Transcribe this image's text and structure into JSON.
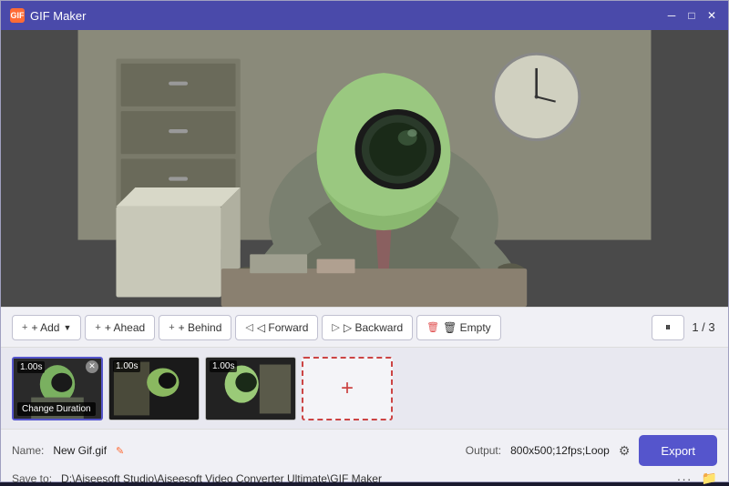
{
  "titlebar": {
    "title": "GIF Maker",
    "icon_label": "GIF",
    "minimize_label": "─",
    "maximize_label": "□",
    "close_label": "✕"
  },
  "toolbar": {
    "add_label": "+ Add",
    "ahead_label": "+ Ahead",
    "behind_label": "+ Behind",
    "forward_label": "◁ Forward",
    "backward_label": "▷ Backward",
    "empty_label": "🗑 Empty",
    "pause_label": "⏸",
    "page_indicator": "1 / 3"
  },
  "frames": [
    {
      "id": 1,
      "duration": "1.00s",
      "active": true,
      "has_close": true,
      "label": "Change Duration"
    },
    {
      "id": 2,
      "duration": "1.00s",
      "active": false,
      "has_close": false,
      "label": ""
    },
    {
      "id": 3,
      "duration": "1.00s",
      "active": false,
      "has_close": false,
      "label": ""
    }
  ],
  "bottom": {
    "name_label": "Name:",
    "name_value": "New Gif.gif",
    "output_label": "Output:",
    "output_value": "800x500;12fps;Loop",
    "save_label": "Save to:",
    "save_path": "D:\\Aiseesoft Studio\\Aiseesoft Video Converter Ultimate\\GIF Maker",
    "export_label": "Export"
  }
}
